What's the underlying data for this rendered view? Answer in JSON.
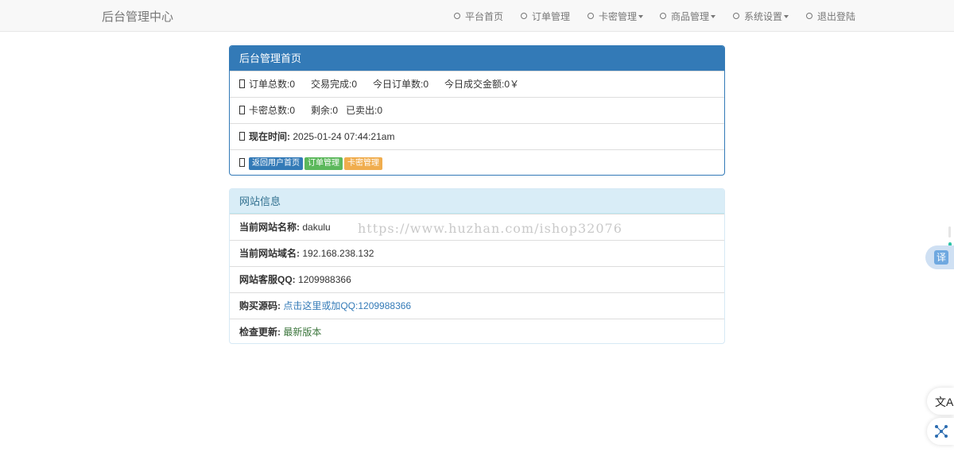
{
  "navbar": {
    "brand": "后台管理中心",
    "items": [
      {
        "label": "平台首页",
        "dropdown": false
      },
      {
        "label": "订单管理",
        "dropdown": false
      },
      {
        "label": "卡密管理",
        "dropdown": true
      },
      {
        "label": "商品管理",
        "dropdown": true
      },
      {
        "label": "系统设置",
        "dropdown": true
      },
      {
        "label": "退出登陆",
        "dropdown": false
      }
    ]
  },
  "dashboard": {
    "title": "后台管理首页",
    "orders": {
      "total": "订单总数:0",
      "completed": "交易完成:0",
      "today_orders": "今日订单数:0",
      "today_amount": "今日成交金额:0￥"
    },
    "cards": {
      "total": "卡密总数:0",
      "remaining": "剩余:0",
      "sold": "已卖出:0"
    },
    "time": {
      "label": "现在时间:",
      "value": "2025-01-24 07:44:21am"
    },
    "buttons": {
      "home": "返回用户首页",
      "orders": "订单管理",
      "cards": "卡密管理"
    }
  },
  "site_info": {
    "title": "网站信息",
    "name_label": "当前网站名称:",
    "name_value": "dakulu",
    "domain_label": "当前网站域名:",
    "domain_value": "192.168.238.132",
    "qq_label": "网站客服QQ:",
    "qq_value": "1209988366",
    "buy_label": "购买源码:",
    "buy_link": "点击这里或加QQ:1209988366",
    "update_label": "检查更新:",
    "update_value": "最新版本"
  },
  "watermark": "https://www.huzhan.com/ishop32076",
  "widgets": {
    "translate": "译",
    "accessibility_glyph": "文A"
  },
  "colors": {
    "primary": "#337ab7",
    "success": "#5cb85c",
    "warning": "#f0ad4e",
    "info_bg": "#d9edf7",
    "info_text": "#31708f"
  }
}
